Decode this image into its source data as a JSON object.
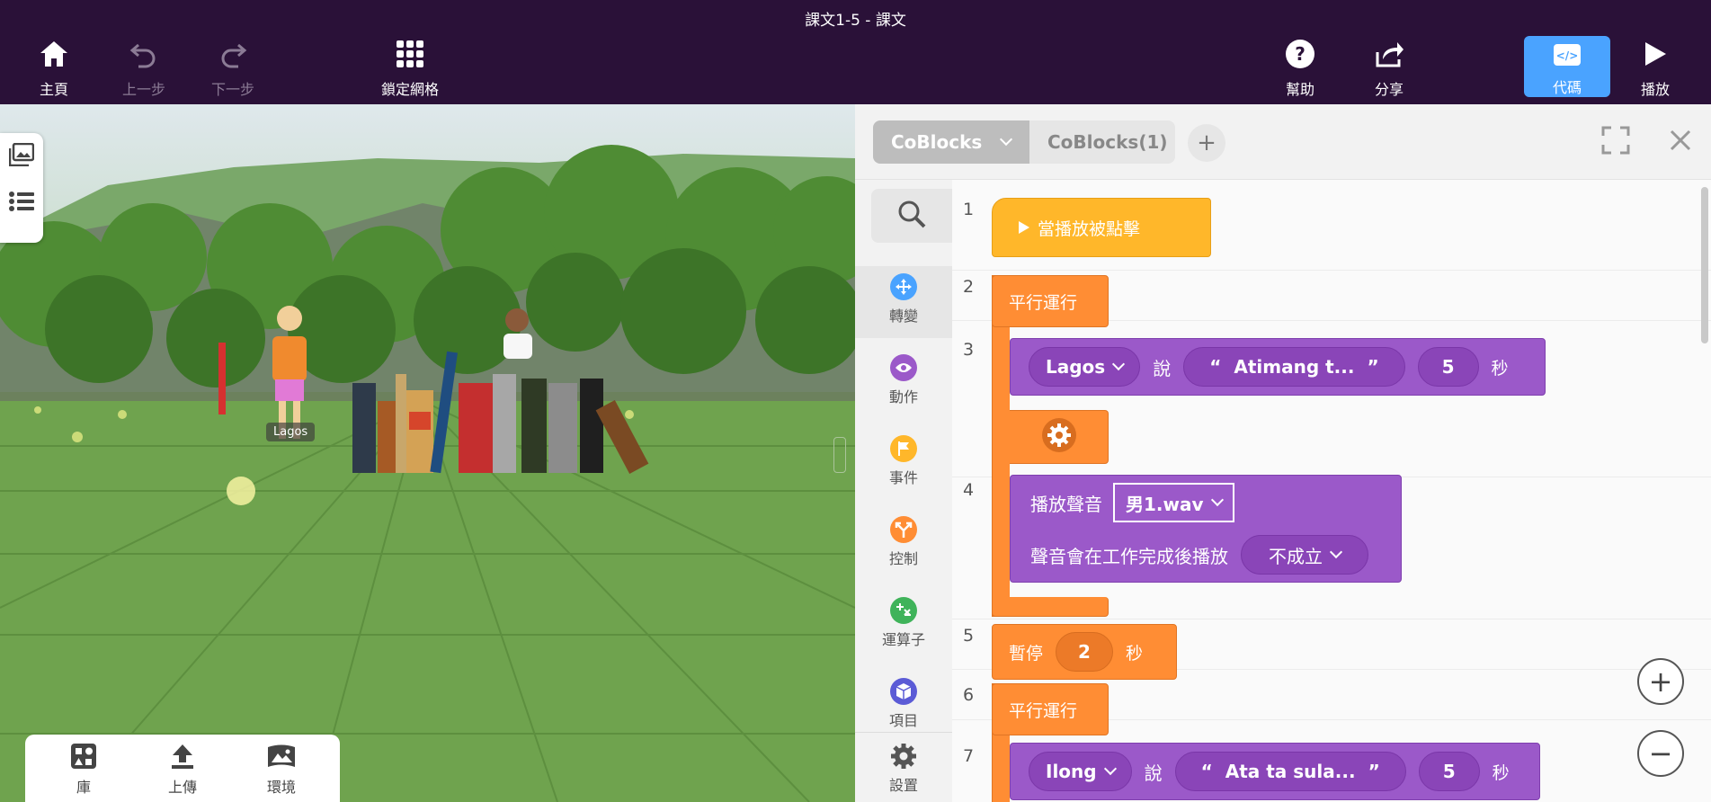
{
  "window": {
    "title": "課文1-5 - 課文"
  },
  "toolbar": {
    "home": "主頁",
    "undo": "上一步",
    "redo": "下一步",
    "grid": "鎖定網格",
    "help": "幫助",
    "share": "分享",
    "code": "代碼",
    "play": "播放"
  },
  "scene": {
    "character_label": "Lagos",
    "bottom_tools": [
      "庫",
      "上傳",
      "環境"
    ]
  },
  "panel": {
    "tabs": [
      {
        "label": "CoBlocks"
      },
      {
        "label": "CoBlocks(1)"
      }
    ],
    "categories": [
      {
        "label": "轉變",
        "color": "#4aa3ff"
      },
      {
        "label": "動作",
        "color": "#9b59c9"
      },
      {
        "label": "事件",
        "color": "#ffb72a"
      },
      {
        "label": "控制",
        "color": "#ff8d34"
      },
      {
        "label": "運算子",
        "color": "#3fb35a"
      },
      {
        "label": "項目",
        "color": "#5b5bd6"
      },
      {
        "label": "設置",
        "color": "#555555"
      }
    ]
  },
  "code": {
    "line_numbers": [
      "1",
      "2",
      "3",
      "4",
      "5",
      "6",
      "7"
    ],
    "when_play": "當播放被點擊",
    "parallel": "平行運行",
    "say1": {
      "actor": "Lagos",
      "verb": "說",
      "text": "Atimang t...",
      "open_quote": "“",
      "close_quote": "”",
      "seconds": "5",
      "unit": "秒"
    },
    "play_sound": "播放聲音",
    "sound_file": "男1.wav",
    "sound_wait_label": "聲音會在工作完成後播放",
    "sound_wait_value": "不成立",
    "pause": "暫停",
    "pause_seconds": "2",
    "pause_unit": "秒",
    "parallel2": "平行運行",
    "say2": {
      "actor": "Ilong",
      "verb": "說",
      "text": "Ata ta sula...",
      "open_quote": "“",
      "close_quote": "”",
      "seconds": "5",
      "unit": "秒"
    }
  },
  "colors": {
    "topbar": "#2a1138",
    "accent": "#4aa3ff",
    "control": "#ff8d34",
    "event": "#ffb72a",
    "action": "#9b59c9"
  }
}
